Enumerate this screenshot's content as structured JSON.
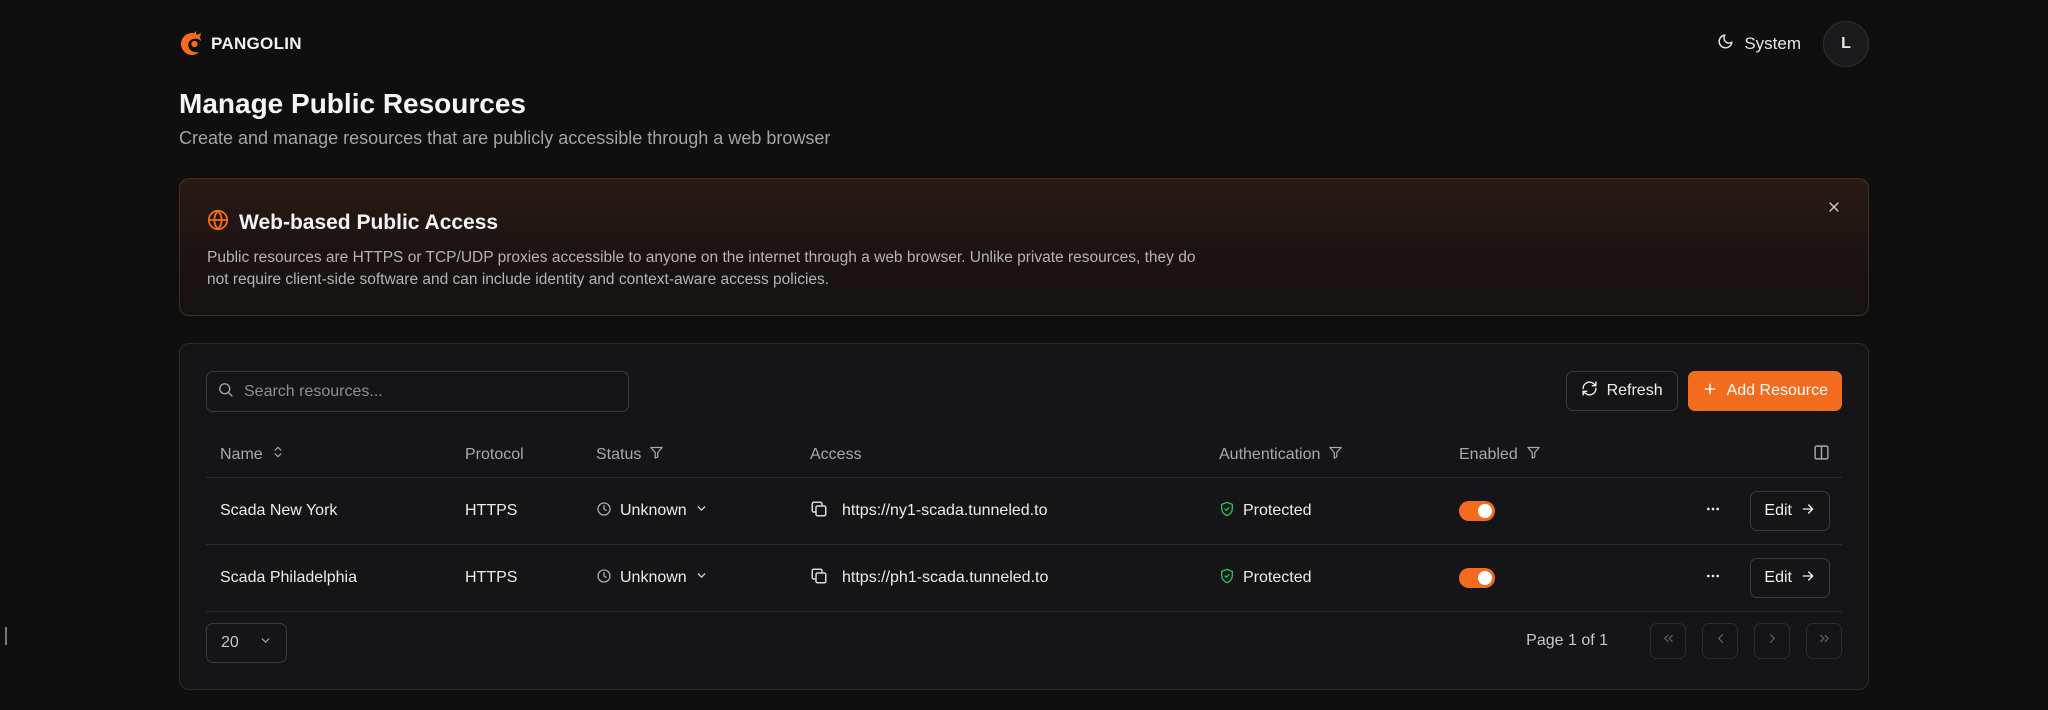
{
  "header": {
    "brand": "PANGOLIN",
    "theme_label": "System",
    "avatar_initial": "L"
  },
  "page": {
    "title": "Manage Public Resources",
    "subtitle": "Create and manage resources that are publicly accessible through a web browser"
  },
  "banner": {
    "title": "Web-based Public Access",
    "text": "Public resources are HTTPS or TCP/UDP proxies accessible to anyone on the internet through a web browser. Unlike private resources, they do not require client-side software and can include identity and context-aware access policies."
  },
  "toolbar": {
    "search_placeholder": "Search resources...",
    "refresh_label": "Refresh",
    "add_label": "Add Resource"
  },
  "table": {
    "columns": {
      "name": "Name",
      "protocol": "Protocol",
      "status": "Status",
      "access": "Access",
      "authentication": "Authentication",
      "enabled": "Enabled"
    },
    "rows": [
      {
        "name": "Scada New York",
        "protocol": "HTTPS",
        "status": "Unknown",
        "access": "https://ny1-scada.tunneled.to",
        "authentication": "Protected",
        "enabled": true,
        "edit_label": "Edit"
      },
      {
        "name": "Scada Philadelphia",
        "protocol": "HTTPS",
        "status": "Unknown",
        "access": "https://ph1-scada.tunneled.to",
        "authentication": "Protected",
        "enabled": true,
        "edit_label": "Edit"
      }
    ]
  },
  "footer": {
    "page_size": "20",
    "page_label": "Page 1 of 1"
  },
  "colors": {
    "accent": "#f36b1c",
    "background": "#0f0f10",
    "protected_green": "#22c55e"
  }
}
